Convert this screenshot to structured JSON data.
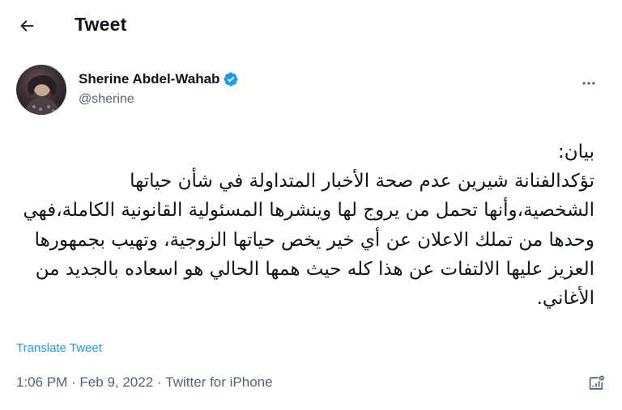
{
  "header": {
    "title": "Tweet",
    "back_icon": "arrow-left-icon"
  },
  "author": {
    "name": "Sherine Abdel-Wahab",
    "handle": "@sherine",
    "verified": true,
    "verified_color": "#1d9bf0"
  },
  "tweet": {
    "text": "بيان:\nتؤكدالفنانة شيرين عدم صحة الأخبار المتداولة في شأن حياتها الشخصية،وأنها تحمل من يروج لها وينشرها المسئولية القانونية الكاملة،فهي وحدها من تملك الاعلان عن أي خير يخص حياتها الزوجية، وتهيب بجمهورها العزيز عليها الالتفات عن هذا كله حيث همها الحالي هو اسعاده بالجديد من الأغاني.",
    "translate_label": "Translate Tweet",
    "time": "1:06 PM",
    "date": "Feb 9, 2022",
    "source": "Twitter for iPhone",
    "separator": " · "
  },
  "colors": {
    "text": "#0f1419",
    "secondary": "#536471",
    "accent": "#1d9bf0"
  }
}
